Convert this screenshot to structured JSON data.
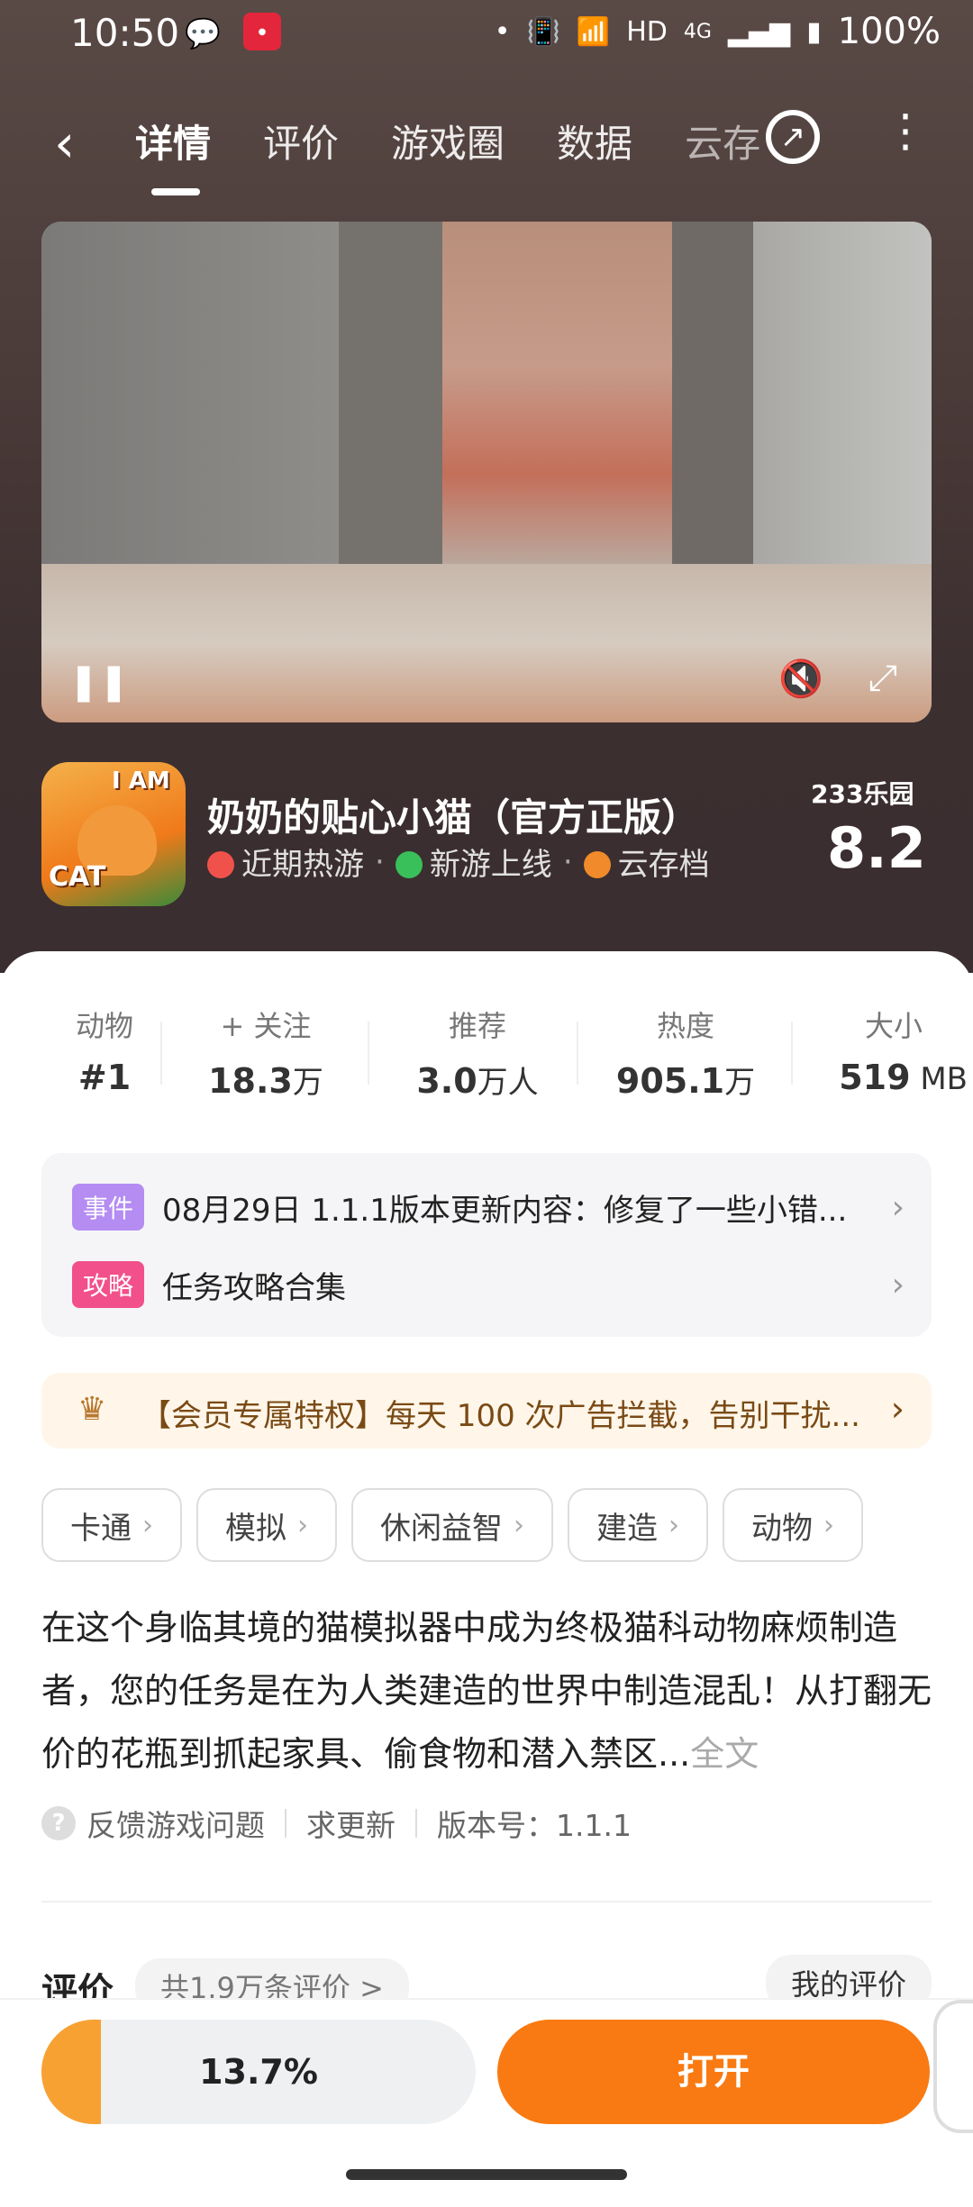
{
  "status": {
    "time": "10:50",
    "network": "HD",
    "net_gen": "4G",
    "battery": "100%"
  },
  "nav": {
    "tabs": [
      "详情",
      "评价",
      "游戏圈",
      "数据",
      "云存"
    ]
  },
  "game": {
    "title": "奶奶的贴心小猫（官方正版）",
    "icon_text_top": "I AM",
    "icon_text_bottom": "CAT",
    "tags": [
      "近期热游",
      "新游上线",
      "云存档"
    ],
    "brand": "233乐园",
    "score": "8.2"
  },
  "stats": [
    {
      "label": "动物",
      "value": "#1",
      "unit": ""
    },
    {
      "label": "+ 关注",
      "value": "18.3",
      "unit": "万"
    },
    {
      "label": "推荐",
      "value": "3.0",
      "unit": "万人"
    },
    {
      "label": "热度",
      "value": "905.1",
      "unit": "万"
    },
    {
      "label": "大小",
      "value": "519",
      "unit": " MB"
    }
  ],
  "events": [
    {
      "badge": "事件",
      "badge_color": "#b48cf2",
      "text": "08月29日  1.1.1版本更新内容：修复了一些小错..."
    },
    {
      "badge": "攻略",
      "badge_color": "#f2508a",
      "text": "任务攻略合集"
    }
  ],
  "vip": {
    "text": "【会员专属特权】每天 100 次广告拦截，告别干扰..."
  },
  "chips": [
    "卡通",
    "模拟",
    "休闲益智",
    "建造",
    "动物"
  ],
  "description": {
    "text": "在这个身临其境的猫模拟器中成为终极猫科动物麻烦制造者，您的任务是在为人类建造的世界中制造混乱！从打翻无价的花瓶到抓起家具、偷食物和潜入禁区...",
    "more": "全文"
  },
  "meta": {
    "feedback": "反馈游戏问题",
    "update": "求更新",
    "version": "版本号：1.1.1"
  },
  "reviews": {
    "title": "评价",
    "count": "共1.9万条评价 >",
    "mine": "我的评价"
  },
  "bottom": {
    "progress_label": "13.7%",
    "progress_value": 0.137,
    "open": "打开"
  },
  "colors": {
    "accent": "#f97a12",
    "progress": "#f7a133"
  }
}
